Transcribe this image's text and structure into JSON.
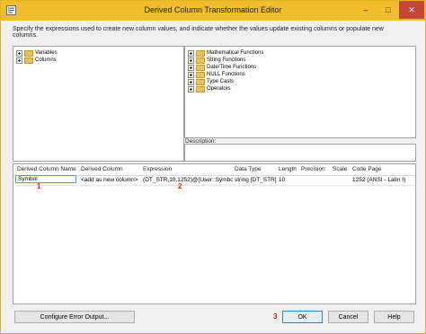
{
  "window": {
    "title": "Derived Column Transformation Editor"
  },
  "caption_buttons": {
    "minimize": "–",
    "maximize": "□",
    "close": "✕"
  },
  "instructions": "Specify the expressions used to create new column values, and indicate whether the values update existing columns or populate new columns.",
  "left_tree": {
    "items": [
      {
        "label": "Variables"
      },
      {
        "label": "Columns"
      }
    ]
  },
  "right_tree": {
    "items": [
      {
        "label": "Mathematical Functions"
      },
      {
        "label": "String Functions"
      },
      {
        "label": "Date/Time Functions"
      },
      {
        "label": "NULL Functions"
      },
      {
        "label": "Type Casts"
      },
      {
        "label": "Operators"
      }
    ]
  },
  "description": {
    "label": "Description:"
  },
  "grid": {
    "headers": [
      "Derived Column Name",
      "Derived Column",
      "Expression",
      "Data Type",
      "Length",
      "Precision",
      "Scale",
      "Code Page"
    ],
    "row": {
      "name": "Symbol",
      "derived_column": "<add as new column>",
      "expression": "(DT_STR,10,1252)@[User::Symbol]",
      "data_type": "string [DT_STR]",
      "length": "10",
      "precision": "",
      "scale": "",
      "code_page": "1252  (ANSI - Latin I)"
    }
  },
  "markers": {
    "m1": "1",
    "m2": "2",
    "m3": "3"
  },
  "buttons": {
    "configure_error_output": "Configure Error Output...",
    "ok": "OK",
    "cancel": "Cancel",
    "help": "Help"
  },
  "colors": {
    "title_bar": "#f1bd2d",
    "close_button": "#c7463a",
    "marker": "#d11e1e"
  }
}
